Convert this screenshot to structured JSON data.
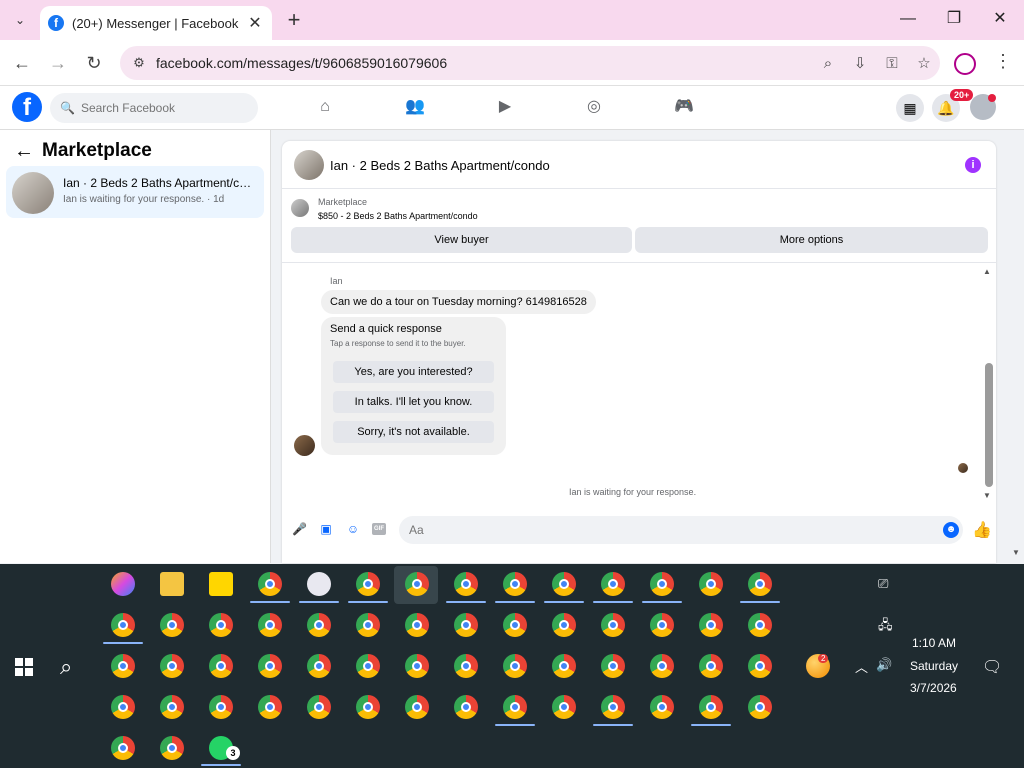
{
  "browser": {
    "tab_title": "(20+) Messenger | Facebook",
    "url": "facebook.com/messages/t/9606859016079606",
    "new_tab": "+",
    "close_tab": "✕"
  },
  "facebook": {
    "search_placeholder": "Search Facebook",
    "notification_badge": "20+"
  },
  "sidebar": {
    "title": "Marketplace",
    "conversations": [
      {
        "name": "Ian · 2 Beds 2 Baths Apartment/condo",
        "preview": "Ian is waiting for your response. · 1d"
      }
    ]
  },
  "conversation": {
    "title": "Ian · 2 Beds 2 Baths Apartment/condo",
    "marketplace_label": "Marketplace",
    "listing": "$850 - 2 Beds 2 Baths Apartment/condo",
    "view_buyer": "View buyer",
    "more_options": "More options",
    "sender": "Ian",
    "message": "Can we do a tour on Tuesday morning? 6149816528",
    "quick_response_title": "Send a quick response",
    "quick_response_sub": "Tap a response to send it to the buyer.",
    "quick_responses": [
      "Yes, are you interested?",
      "In talks. I'll let you know.",
      "Sorry, it's not available."
    ],
    "waiting_text": "Ian is waiting for your response.",
    "composer_placeholder": "Aa",
    "gif_label": "GIF"
  },
  "taskbar": {
    "time": "1:10 AM",
    "day": "Saturday",
    "date": "3/7/2026",
    "whatsapp_count": "3",
    "tray_badge": "2"
  }
}
